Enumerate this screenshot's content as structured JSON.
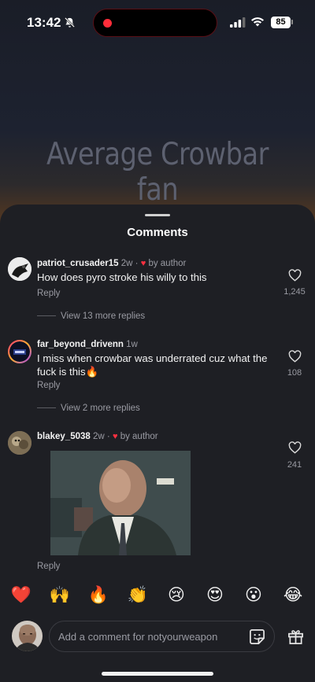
{
  "status_bar": {
    "time": "13:42",
    "battery": "85",
    "icons": [
      "mute-bell-icon",
      "cellular-signal-icon",
      "wifi-icon",
      "battery-icon",
      "recording-dot-icon"
    ]
  },
  "video": {
    "caption": "Average Crowbar fan"
  },
  "comments_sheet": {
    "title": "Comments",
    "comments": [
      {
        "username": "patriot_crusader15",
        "age": "2w",
        "liked_by_author": "by author",
        "text": "How does pyro stroke his willy to this",
        "reply_label": "Reply",
        "likes": "1,245",
        "view_more": "View 13 more replies"
      },
      {
        "username": "far_beyond_drivenn",
        "age": "1w",
        "text": "I miss when crowbar was underrated cuz what the fuck is this🔥",
        "reply_label": "Reply",
        "likes": "108",
        "view_more": "View 2 more replies"
      },
      {
        "username": "blakey_5038",
        "age": "2w",
        "liked_by_author": "by author",
        "media": "gif-image",
        "reply_label": "Reply",
        "likes": "241"
      }
    ]
  },
  "reactions": [
    "❤️",
    "🙌",
    "🔥",
    "👏",
    "😢",
    "😍",
    "😮",
    "😂"
  ],
  "composer": {
    "placeholder": "Add a comment for notyourweapon",
    "icons": [
      "sticker-icon",
      "gift-icon"
    ]
  },
  "colors": {
    "sheet_bg": "#1e1f24",
    "like_red": "#ff3040",
    "muted_text": "#9a9ba3"
  }
}
